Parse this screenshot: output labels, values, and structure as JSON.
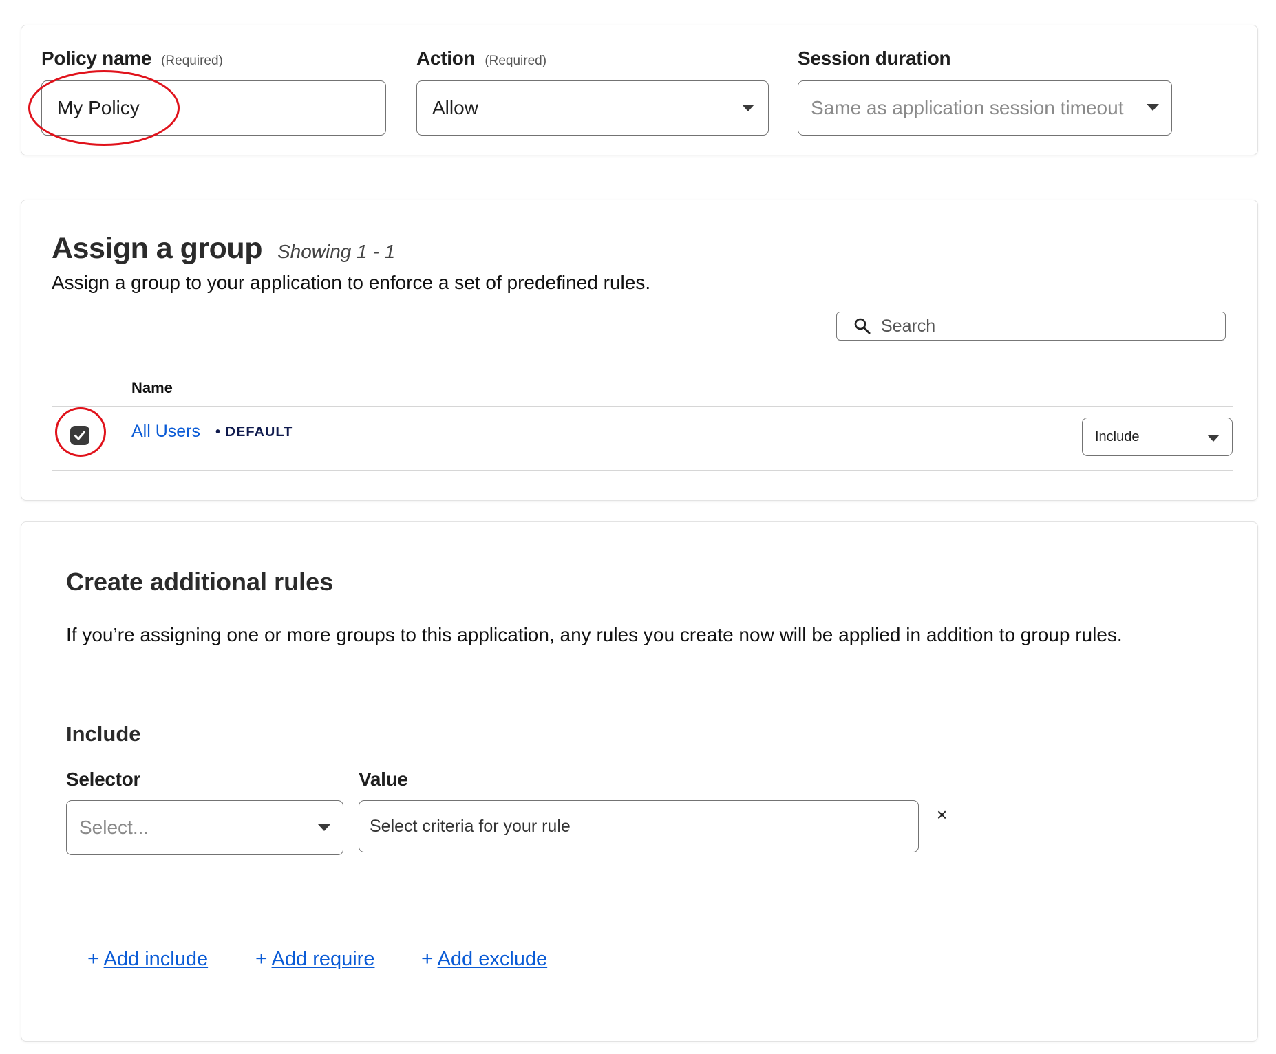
{
  "policy": {
    "policy_name_label": "Policy name",
    "policy_name_required": "(Required)",
    "policy_name_value": "My Policy",
    "action_label": "Action",
    "action_required": "(Required)",
    "action_value": "Allow",
    "session_label": "Session duration",
    "session_placeholder": "Same as application session timeout"
  },
  "group": {
    "title": "Assign a group",
    "showing": "Showing 1 - 1",
    "description": "Assign a group to your application to enforce a set of predefined rules.",
    "search_placeholder": "Search",
    "column_name": "Name",
    "rows": [
      {
        "name": "All Users",
        "badge": "• DEFAULT",
        "checked": true,
        "mode": "Include"
      }
    ]
  },
  "rules": {
    "title": "Create additional rules",
    "description": "If you’re assigning one or more groups to this application, any rules you create now will be applied in addition to group rules.",
    "include_heading": "Include",
    "selector_label": "Selector",
    "selector_placeholder": "Select...",
    "value_label": "Value",
    "value_placeholder": "Select criteria for your rule",
    "remove_symbol": "×",
    "add_links": [
      {
        "plus": "+",
        "label": "Add include"
      },
      {
        "plus": "+",
        "label": "Add require"
      },
      {
        "plus": "+",
        "label": "Add exclude"
      }
    ]
  },
  "colors": {
    "link": "#0a5bd6",
    "annotation": "#e0121b",
    "checkbox": "#3a3a3a",
    "badge": "#0f1a4d"
  }
}
